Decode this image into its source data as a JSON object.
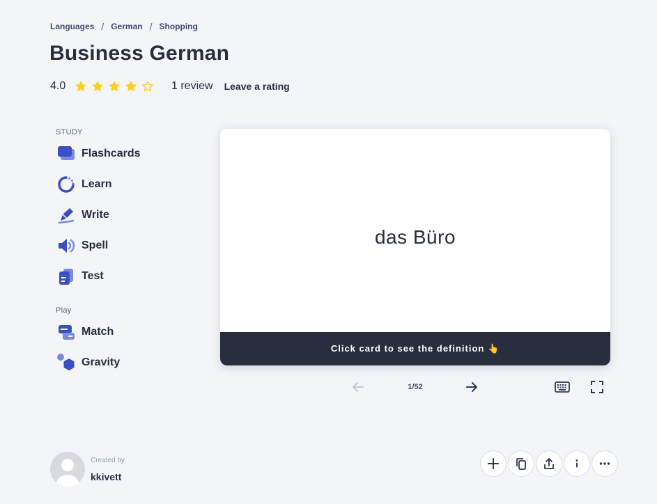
{
  "breadcrumb": {
    "items": [
      "Languages",
      "German",
      "Shopping"
    ],
    "separator": "/"
  },
  "set": {
    "title": "Business German",
    "rating_value": "4.0",
    "rating_stars": 4,
    "rating_max": 5,
    "review_count": "1 review",
    "leave_rating": "Leave a rating"
  },
  "sidebar": {
    "study_heading": "STUDY",
    "study_items": [
      {
        "label": "Flashcards",
        "icon": "flashcards-icon"
      },
      {
        "label": "Learn",
        "icon": "learn-icon"
      },
      {
        "label": "Write",
        "icon": "write-icon"
      },
      {
        "label": "Spell",
        "icon": "spell-icon"
      },
      {
        "label": "Test",
        "icon": "test-icon"
      }
    ],
    "play_heading": "Play",
    "play_items": [
      {
        "label": "Match",
        "icon": "match-icon"
      },
      {
        "label": "Gravity",
        "icon": "gravity-icon"
      }
    ]
  },
  "card": {
    "term": "das Büro",
    "hint": "Click card to see the definition 👆"
  },
  "controls": {
    "counter": "1/52"
  },
  "creator": {
    "created_by": "Created by",
    "username": "kkivett"
  },
  "colors": {
    "accent": "#4255ff",
    "icon_blue": "#3b4fc4",
    "star": "#ffcd1f",
    "card_footer": "#282e3e",
    "background": "#f4f5f9"
  }
}
